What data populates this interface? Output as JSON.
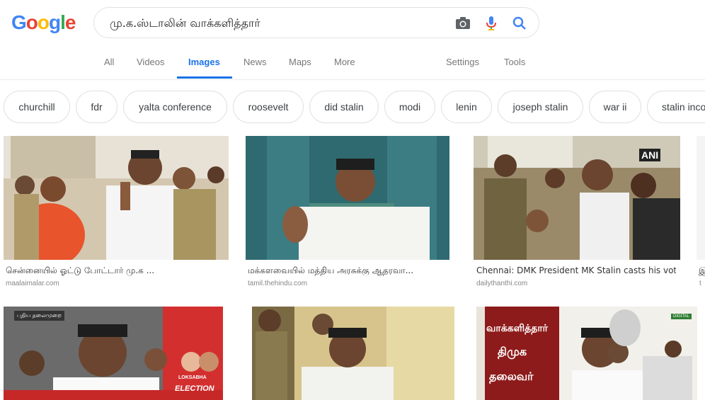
{
  "header": {
    "logo": "Google",
    "query": "மு.க.ஸ்டாலின் வாக்களித்தார்"
  },
  "nav": {
    "tabs": [
      "All",
      "Videos",
      "Images",
      "News",
      "Maps",
      "More"
    ],
    "active": "Images",
    "settings": "Settings",
    "tools": "Tools"
  },
  "chips": [
    "churchill",
    "fdr",
    "yalta conference",
    "roosevelt",
    "did stalin",
    "modi",
    "lenin",
    "joseph stalin",
    "war ii",
    "stalin inco"
  ],
  "results": [
    {
      "caption": "சென்னையில் ஓட்டு போட்டார் மு.க ...",
      "source": "maalaimalar.com"
    },
    {
      "caption": "மக்களவையில் மத்திய அரசுக்கு ஆதரவா...",
      "source": "tamil.thehindu.com"
    },
    {
      "caption": "Chennai: DMK President MK Stalin casts his vot...",
      "source": "dailythanthi.com"
    },
    {
      "caption": "இ",
      "source": "t"
    },
    {
      "overlay_badge": "புதிய தலைமுறை",
      "overlay_election": "ELECTION",
      "overlay_lok": "LOKSABHA"
    },
    {},
    {
      "badge": "DIGITAL",
      "text_lines": [
        "வாக்களித்தார்",
        "திமுக",
        "தலைவர்"
      ]
    }
  ],
  "overlay": {
    "ani": "ANI"
  },
  "colors": {
    "accent": "#1a73e8",
    "chip_border": "#dfe1e5"
  }
}
